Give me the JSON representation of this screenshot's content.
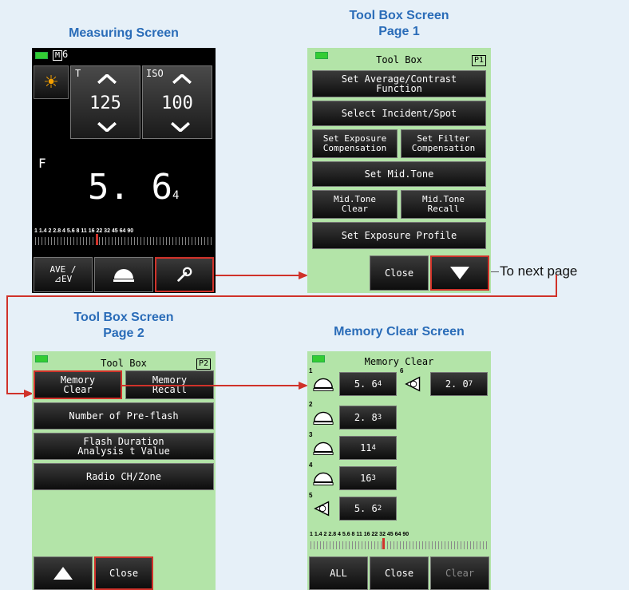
{
  "captions": {
    "measuring": "Measuring Screen",
    "toolbox1_line1": "Tool Box Screen",
    "toolbox1_line2": "Page 1",
    "toolbox2_line1": "Tool Box Screen",
    "toolbox2_line2": "Page 2",
    "memclear": "Memory Clear Screen",
    "next_page": "To next page"
  },
  "measuring": {
    "mode": "M",
    "mode_num": "6",
    "t_label": "T",
    "t_value": "125",
    "iso_label": "ISO",
    "iso_value": "100",
    "f_label": "F",
    "f_value": "5. 6",
    "f_sub": "4",
    "scale": "1  1.4  2  2.8  4  5.6  8  11  16  22  32  45  64  90",
    "btn_ave": "AVE /",
    "btn_ev": "⊿EV"
  },
  "toolbox1": {
    "title": "Tool Box",
    "page": "P1",
    "btn1": "Set Average/Contrast\nFunction",
    "btn2": "Select Incident/Spot",
    "btn3a": "Set Exposure\nCompensation",
    "btn3b": "Set Filter\nCompensation",
    "btn4": "Set Mid.Tone",
    "btn5a": "Mid.Tone\nClear",
    "btn5b": "Mid.Tone\nRecall",
    "btn6": "Set Exposure Profile",
    "close": "Close"
  },
  "toolbox2": {
    "title": "Tool Box",
    "page": "P2",
    "btn1a": "Memory\nClear",
    "btn1b": "Memory\nRecall",
    "btn2": "Number of Pre-flash",
    "btn3": "Flash Duration\nAnalysis t Value",
    "btn4": "Radio CH/Zone",
    "close": "Close"
  },
  "memclear": {
    "title": "Memory Clear",
    "items": [
      {
        "num": "1",
        "val": "5. 6",
        "sub": "4"
      },
      {
        "num": "2",
        "val": "2. 8",
        "sub": "3"
      },
      {
        "num": "3",
        "val": "11",
        "sub": "4"
      },
      {
        "num": "4",
        "val": "16",
        "sub": "3"
      },
      {
        "num": "5",
        "val": "5. 6",
        "sub": "2"
      },
      {
        "num": "6",
        "val": "2. 0",
        "sub": "7"
      }
    ],
    "scale": "1  1.4  2  2.8  4  5.6  8  11  16  22  32  45  64  90",
    "btn_all": "ALL",
    "btn_close": "Close",
    "btn_clear": "Clear"
  }
}
